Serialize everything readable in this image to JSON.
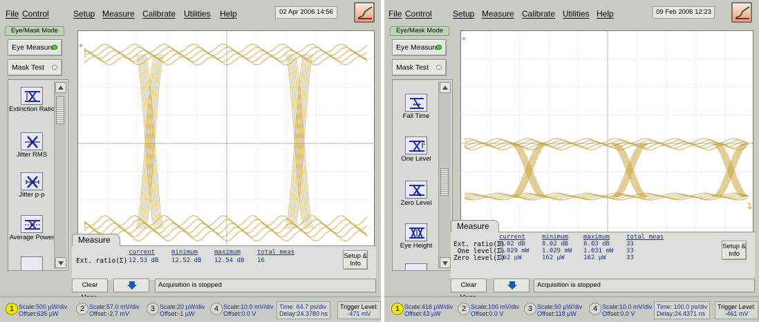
{
  "left": {
    "menu": [
      "File",
      "Control",
      "Setup",
      "Measure",
      "Calibrate",
      "Utilities",
      "Help"
    ],
    "datetime": "02 Apr 2006 14:56",
    "mode_tab": "Eye/Mask Mode",
    "eye_measure_label": "Eye Measure",
    "mask_test_label": "Mask Test",
    "tools": [
      {
        "label": "Extinction Ratio",
        "icon": "extinction-ratio-icon"
      },
      {
        "label": "Jitter RMS",
        "icon": "jitter-rms-icon"
      },
      {
        "label": "Jitter p-p",
        "icon": "jitter-pp-icon"
      },
      {
        "label": "Average Power",
        "icon": "average-power-icon"
      }
    ],
    "measure_tab": "Measure",
    "measure_headers": [
      "current",
      "minimum",
      "maximum",
      "total meas"
    ],
    "measure_rows": [
      {
        "label": "Ext. ratio(Σ)",
        "current": "12.53 dB",
        "minimum": "12.52 dB",
        "maximum": "12.54 dB",
        "total": "16"
      }
    ],
    "setup_info_label": "Setup & Info",
    "clear_meas_label": "Clear Meas.",
    "status_text": "Acquisition is stopped",
    "channels": [
      {
        "num": "1",
        "scale": "Scale:500 µW/div",
        "offset": "Offset:635 µW",
        "active": true
      },
      {
        "num": "2",
        "scale": "Scale:57.0 mV/div",
        "offset": "Offset:-2.7 mV",
        "active": false
      },
      {
        "num": "3",
        "scale": "Scale:20 µW/div",
        "offset": "Offset:-1 µW",
        "active": false
      },
      {
        "num": "4",
        "scale": "Scale:10.0 mV/div",
        "offset": "Offset:0.0 V",
        "active": false
      }
    ],
    "time": {
      "line1": "Time: 64.7 ps/div",
      "line2": "Delay:24.3780 ns"
    },
    "trigger": {
      "line1": "Trigger Level:",
      "line2": "-471 mV"
    }
  },
  "right": {
    "menu": [
      "File",
      "Control",
      "Setup",
      "Measure",
      "Calibrate",
      "Utilities",
      "Help"
    ],
    "datetime": "09 Feb 2006 12:23",
    "mode_tab": "Eye/Mask Mode",
    "eye_measure_label": "Eye Measure",
    "mask_test_label": "Mask Test",
    "tools": [
      {
        "label": "Fall Time",
        "icon": "fall-time-icon"
      },
      {
        "label": "One Level",
        "icon": "one-level-icon"
      },
      {
        "label": "Zero Level",
        "icon": "zero-level-icon"
      },
      {
        "label": "Eye Height",
        "icon": "eye-height-icon"
      }
    ],
    "measure_tab": "Measure",
    "measure_headers": [
      "current",
      "minimum",
      "maximum",
      "total meas"
    ],
    "measure_rows": [
      {
        "label": "Ext. ratio(Σ)",
        "current": "8.02 dB",
        "minimum": "8.02 dB",
        "maximum": "8.03 dB",
        "total": "33"
      },
      {
        "label": " One level(Σ)",
        "current": "1.029 mW",
        "minimum": "1.029 mW",
        "maximum": "1.031 mW",
        "total": "33"
      },
      {
        "label": "Zero level(Σ)",
        "current": "162 µW",
        "minimum": "162 µW",
        "maximum": "162 µW",
        "total": "33"
      }
    ],
    "setup_info_label": "Setup & Info",
    "clear_meas_label": "Clear Meas.",
    "status_text": "Acquisition is stopped",
    "channels": [
      {
        "num": "1",
        "scale": "Scale:416 µW/div",
        "offset": "Offset:43 µW",
        "active": true
      },
      {
        "num": "2",
        "scale": "Scale:100 mV/div",
        "offset": "Offset:0.0 V",
        "active": false
      },
      {
        "num": "3",
        "scale": "Scale:50 µW/div",
        "offset": "Offset:118 µW",
        "active": false
      },
      {
        "num": "4",
        "scale": "Scale:10.0 mV/div",
        "offset": "Offset:0.0 V",
        "active": false
      }
    ],
    "time": {
      "line1": "Time: 100.0 ps/div",
      "line2": "Delay:24.4371 ns"
    },
    "trigger": {
      "line1": "Trigger Level:",
      "line2": "-461 mV"
    }
  },
  "colors": {
    "trace": "#c9a43b",
    "panel": "#c7cbc4",
    "mode_tab": "#bcd7b1",
    "value_text": "#1b2bb3",
    "active_channel": "#f1e900"
  }
}
